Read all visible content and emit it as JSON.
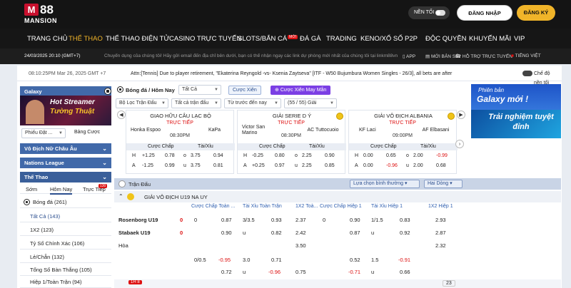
{
  "header": {
    "logo_mark": "M",
    "logo_num": "88",
    "logo_sub": "MANSION",
    "dark_label": "NỀN TỐI",
    "login": "ĐĂNG NHẬP",
    "register": "ĐĂNG KÝ"
  },
  "nav": [
    {
      "label": "TRANG CHỦ",
      "active": false
    },
    {
      "label": "THỂ THAO",
      "active": true
    },
    {
      "label": "THỂ THAO ĐIỆN TỬ",
      "active": false
    },
    {
      "label": "CASINO TRỰC TUYẾN",
      "active": false
    },
    {
      "label": "SLOTS/BẮN CÁ",
      "active": false,
      "badge": "MỚI"
    },
    {
      "label": "ĐÁ GÀ",
      "active": false
    },
    {
      "label": "TRADING",
      "active": false
    },
    {
      "label": "KENO/XỔ SỐ",
      "active": false
    },
    {
      "label": "P2P",
      "active": false
    },
    {
      "label": "ĐỘC QUYỀN",
      "active": false
    },
    {
      "label": "KHUYẾN MÃI",
      "active": false
    },
    {
      "label": "VIP",
      "active": false
    }
  ],
  "ticker": {
    "datetime": "24/03/2025 20:10 (GMT+7)",
    "notice": "Chuyển dụng của chúng tôi! Hãy gửi email đến địa chỉ bên dưới, bạn có thể nhận ngay các link dự phòng mới nhất của chúng tôi tại linkm88vn",
    "app": "APP",
    "news": "MỚI BẢN SẾ",
    "support": "HỖ TRỢ TRỰC TUYẾN",
    "lang": "TIẾNG VIỆT"
  },
  "infobar": {
    "time": "08:10:25PM Mar 26, 2025 GMT +7",
    "message": "Attn:[Tennis] Due to player retirement, \"Ekaterina Reyngold -vs- Ksenia Zaytseva\" [ITF - W50 Bujumbura Women Singles - 26/3], all bets are after",
    "dark": "Chế độ nền tối"
  },
  "sidebar": {
    "galaxy": "Galaxy",
    "banner_line1": "Hot Streamer",
    "banner_line2": "Tường Thuật",
    "sel_left": "Phiếu Đặt ...",
    "sel_right": "Bảng Cược",
    "sec1": "Vô Địch Nữ Châu Âu",
    "sec2": "Nations League",
    "sec3": "Thể Thao",
    "tabs": {
      "t1": "Sớm",
      "t2": "Hôm Nay",
      "t3": "Trực Tiếp",
      "badge": "130"
    },
    "sport": "Bóng đá",
    "sport_count": "(261)",
    "items": [
      {
        "label": "Tất Cả",
        "count": "(143)"
      },
      {
        "label": "1X2",
        "count": "(123)"
      },
      {
        "label": "Tỷ Số Chính Xác",
        "count": "(106)"
      },
      {
        "label": "Lẻ/Chẵn",
        "count": "(132)"
      },
      {
        "label": "Tổng Số Bàn Thắng",
        "count": "(105)"
      },
      {
        "label": "Hiệp 1/Toàn Trận",
        "count": "(94)"
      }
    ]
  },
  "top": {
    "title": "Bóng đá / Hôm Nay",
    "sel_all": "Tất Cả",
    "chip1": "Cược Xiên",
    "chip2": "Cược Xiên May Mắn",
    "filter1": "Bộ Lọc Trận Đấu",
    "filter2": "Tất cả trận đấu",
    "filter3": "Từ trước đến nay",
    "count": "(55 / 55) Giải"
  },
  "cards": [
    {
      "league": "GIAO HỮU CÂU LẠC BỘ",
      "home": "Honka Espoo",
      "away": "KaPa",
      "status": "TRỰC TIẾP",
      "time": "08:30PM",
      "h1": "Cược Chấp",
      "h2": "Tài/Xỉu",
      "r1": {
        "a": "H",
        "b": "+1.25",
        "c": "0.78",
        "d": "o",
        "e": "3.75",
        "f": "0.94"
      },
      "r2": {
        "a": "A",
        "b": "-1.25",
        "c": "0.99",
        "d": "u",
        "e": "3.75",
        "f": "0.81"
      }
    },
    {
      "league": "GIẢI SERIE D Ý",
      "home": "Victor San Marino",
      "away": "AC Tuttocuoio",
      "status": "TRỰC TIẾP",
      "time": "08:30PM",
      "h1": "Cược Chấp",
      "h2": "Tài/Xỉu",
      "r1": {
        "a": "H",
        "b": "-0.25",
        "c": "0.80",
        "d": "o",
        "e": "2.25",
        "f": "0.90"
      },
      "r2": {
        "a": "A",
        "b": "+0.25",
        "c": "0.97",
        "d": "u",
        "e": "2.25",
        "f": "0.85"
      }
    },
    {
      "league": "GIẢI VÔ ĐỊCH ALBANIA",
      "home": "KF Laci",
      "away": "AF Elbasani",
      "status": "TRỰC TIẾP",
      "time": "09:00PM",
      "h1": "Cược Chấp",
      "h2": "Tài/Xỉu",
      "r1": {
        "a": "H",
        "b": "0.00",
        "c": "0.65",
        "d": "o",
        "e": "2.00",
        "f": "-0.99"
      },
      "r2": {
        "a": "A",
        "b": "0.00",
        "c": "-0.96",
        "d": "u",
        "e": "2.00",
        "f": "0.68"
      }
    }
  ],
  "promo": {
    "p1": "Phiên bản",
    "p2": "Galaxy mới !",
    "p3": "Trải nghiệm tuyệt đỉnh"
  },
  "table": {
    "title": "Trận Đấu",
    "dd1": "Lựa chọn bình thường",
    "dd2": "Hai Dòng",
    "league": "GIẢI VÔ ĐỊCH U19 NA UY",
    "cols": [
      "Cược Chấp Toàn ...",
      "Tài Xỉu Toàn Trận",
      "1X2 Toà...",
      "Cược Chấp Hiệp 1",
      "Tài Xỉu Hiệp 1",
      "1X2 Hiệp 1"
    ],
    "home": "Rosenborg U19",
    "away": "Stabaek U19",
    "draw": "Hòa",
    "hs": "0",
    "as": "0",
    "r1": {
      "h": "0",
      "ho": "0.87",
      "t": "3/3.5",
      "to": "0.93",
      "x": "2.37",
      "h1": "0",
      "h1o": "0.90",
      "t1": "1/1.5",
      "t1o": "0.83",
      "x1": "2.93"
    },
    "r2": {
      "ho": "0.90",
      "t": "u",
      "to": "0.82",
      "x": "2.42",
      "h1o": "0.87",
      "t1": "u",
      "t1o": "0.92",
      "x1": "2.87"
    },
    "r3": {
      "x": "3.50",
      "x1": "2.32"
    },
    "r4": {
      "h": "0/0.5",
      "ho": "-0.95",
      "t": "3.0",
      "to": "0.71",
      "h1o": "0.52",
      "t1": "1.5",
      "t1o": "-0.91"
    },
    "r5": {
      "ho": "0.72",
      "t": "u",
      "to": "-0.96",
      "x": "0.75",
      "h1o": "-0.71",
      "t1": "u",
      "t1o": "0.66"
    },
    "live": "1H 8",
    "page": "23"
  }
}
